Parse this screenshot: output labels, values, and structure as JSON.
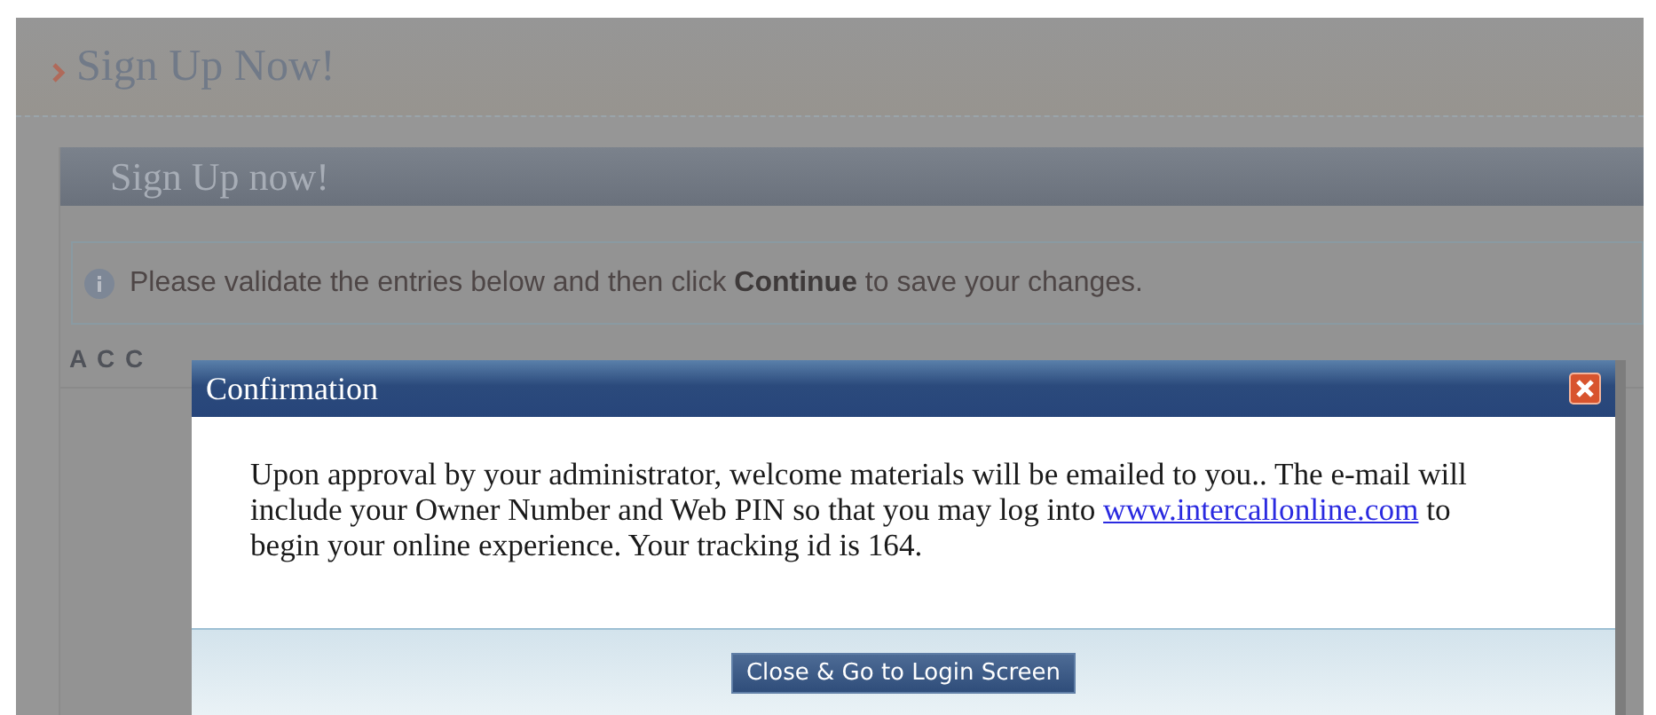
{
  "page_title": "Sign Up Now!",
  "panel": {
    "title": "Sign Up now!",
    "info": "Please validate the entries below and then click **Continue** to save your changes.",
    "section_heading": "A C C"
  },
  "dialog": {
    "title": "Confirmation",
    "message_before": "Upon approval by your administrator, welcome materials will be emailed to you.. The e-mail will include your Owner Number and Web PIN so that you may log into",
    "link": "www.intercallonline.com",
    "message_after": "to begin your online experience. Your tracking id is 164.",
    "button": "Close & Go to Login Screen"
  }
}
